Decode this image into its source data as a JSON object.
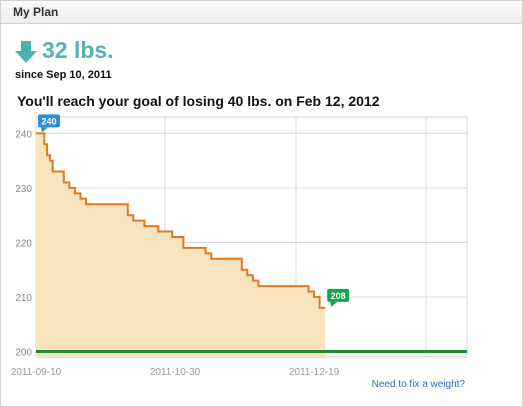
{
  "panel": {
    "title": "My Plan"
  },
  "summary": {
    "loss": "32 lbs.",
    "since": "since Sep 10, 2011",
    "goal_text": "You'll reach your goal of losing 40 lbs. on Feb 12, 2012"
  },
  "link": {
    "fix_weight": "Need to fix a weight?"
  },
  "chart_data": {
    "type": "area",
    "title": "",
    "xlabel": "",
    "ylabel": "",
    "ylim": [
      199,
      243
    ],
    "x_ticks": [
      "2011-09-10",
      "2011-10-30",
      "2011-12-19"
    ],
    "y_ticks": [
      200,
      210,
      220,
      230,
      240
    ],
    "grid": true,
    "series": [
      {
        "x": [
          "2011-09-10",
          "2011-09-11",
          "2011-09-12",
          "2011-09-13",
          "2011-09-14",
          "2011-09-15",
          "2011-09-16",
          "2011-09-18",
          "2011-09-20",
          "2011-09-22",
          "2011-09-24",
          "2011-09-26",
          "2011-09-28",
          "2011-10-04",
          "2011-10-11",
          "2011-10-13",
          "2011-10-15",
          "2011-10-19",
          "2011-10-21",
          "2011-10-24",
          "2011-10-27",
          "2011-10-29",
          "2011-11-02",
          "2011-11-07",
          "2011-11-10",
          "2011-11-12",
          "2011-11-14",
          "2011-11-21",
          "2011-11-23",
          "2011-11-25",
          "2011-11-27",
          "2011-11-29",
          "2011-12-01",
          "2011-12-15",
          "2011-12-17",
          "2011-12-19",
          "2011-12-21",
          "2011-12-23"
        ],
        "values": [
          240,
          240,
          240,
          238,
          236,
          235,
          233,
          233,
          231,
          230,
          229,
          228,
          227,
          227,
          227,
          225,
          224,
          223,
          223,
          222,
          222,
          221,
          219,
          219,
          218,
          217,
          217,
          217,
          215,
          214,
          213,
          212,
          212,
          212,
          211,
          210,
          208,
          208
        ]
      }
    ],
    "goal_line": 200,
    "annotations": [
      {
        "label": "240",
        "x": "2011-09-10",
        "y": 240,
        "color": "#2b8fd8"
      },
      {
        "label": "208",
        "x": "2011-12-23",
        "y": 208,
        "color": "#1aa34a"
      }
    ],
    "colors": {
      "line": "#e07a1e",
      "fill": "#f7e4bd",
      "goal": "#1f8a2e",
      "grid": "#d9d9d9"
    }
  }
}
